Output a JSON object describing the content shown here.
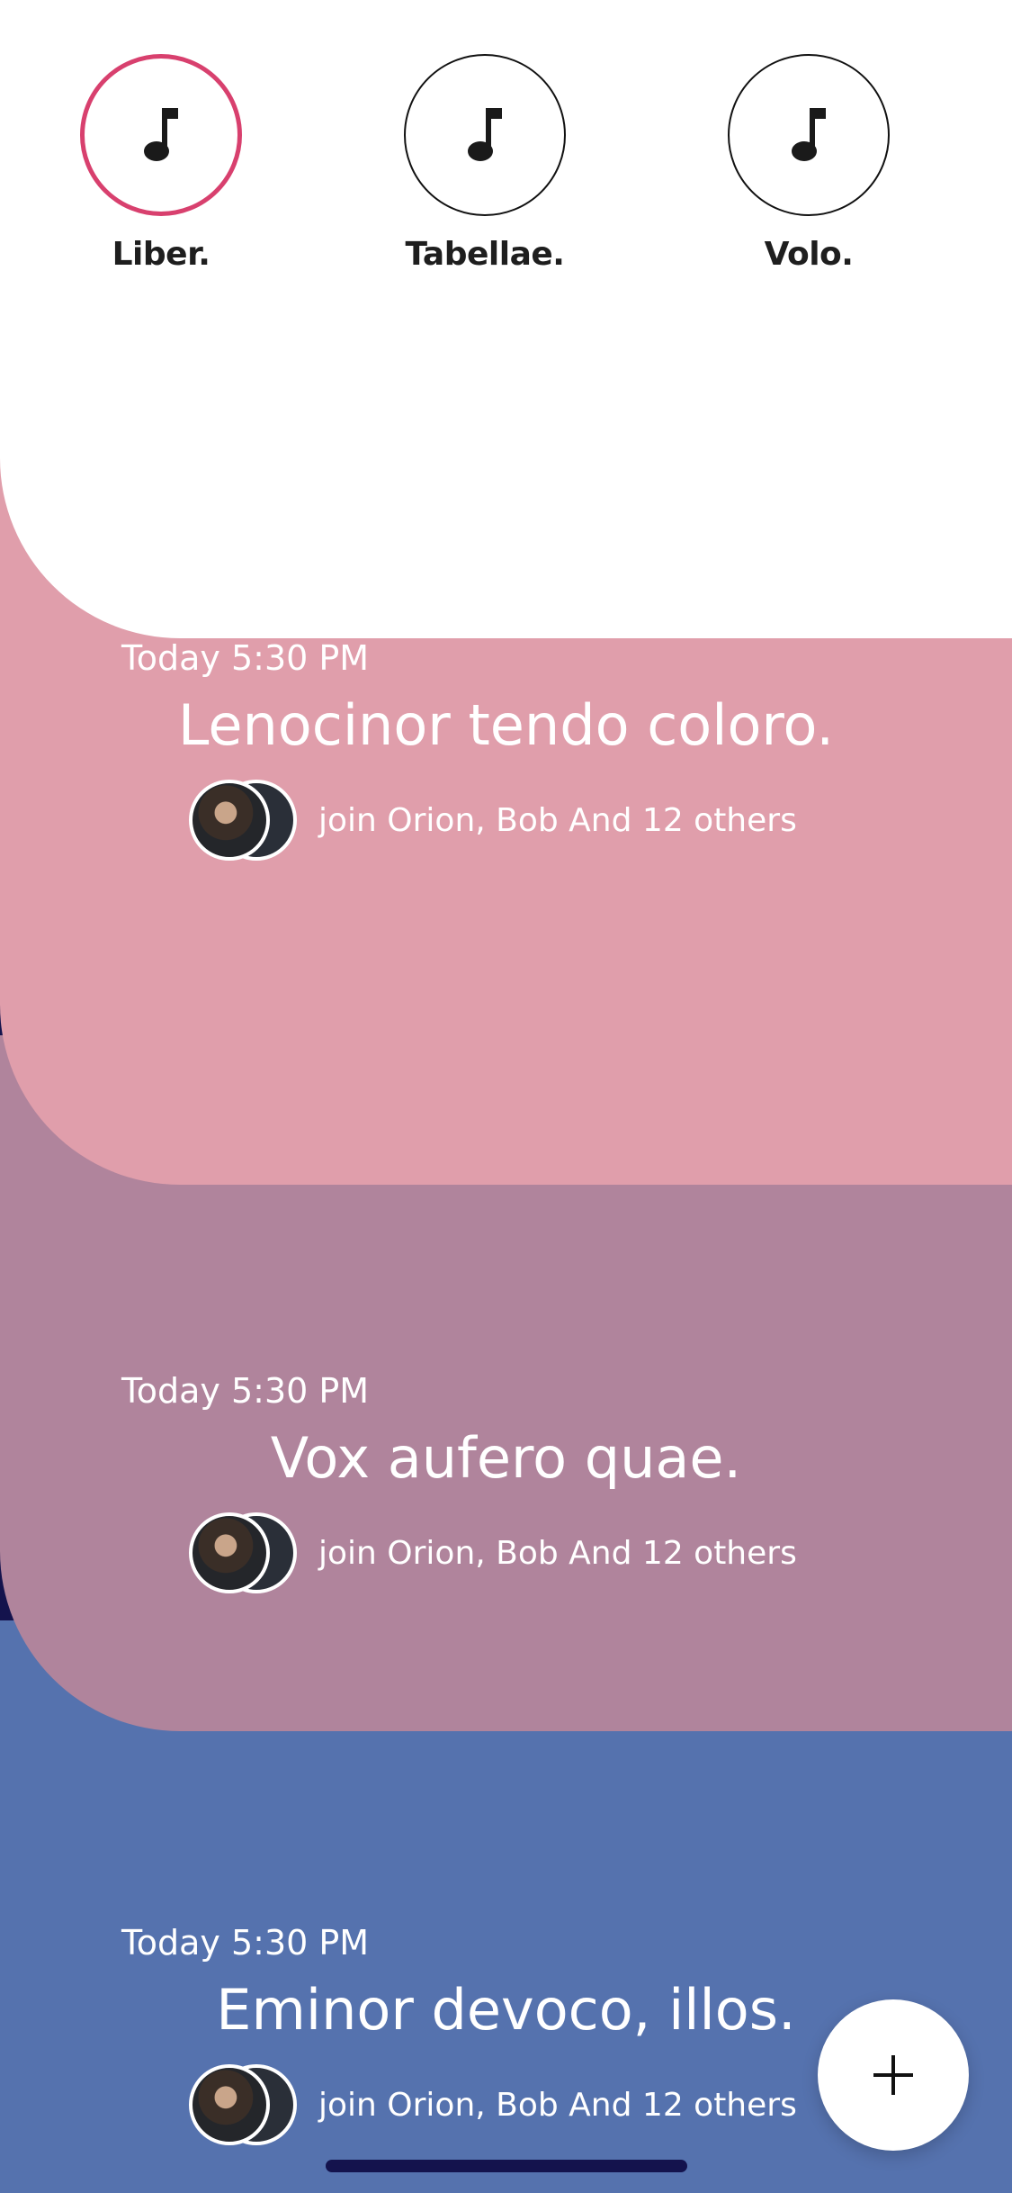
{
  "playlists": [
    {
      "label": "Liber.",
      "icon": "music-note-icon",
      "active": true
    },
    {
      "label": "Tabellae.",
      "icon": "music-note-icon",
      "active": false
    },
    {
      "label": "Volo.",
      "icon": "music-note-icon",
      "active": false
    }
  ],
  "events": [
    {
      "time": "Today 5:30 PM",
      "title": "Lenocinor tendo coloro.",
      "attendees": "join Orion, Bob And 12 others",
      "color": "#e09eab"
    },
    {
      "time": "Today 5:30 PM",
      "title": "Vox aufero quae.",
      "attendees": "join Orion, Bob And 12 others",
      "color": "#b0849c"
    },
    {
      "time": "Today 5:30 PM",
      "title": "Eminor devoco, illos.",
      "attendees": "join Orion, Bob And 12 others",
      "color": "#5572ae"
    }
  ],
  "colors": {
    "accent": "#d8406e",
    "background": "#14134d"
  },
  "fab": {
    "icon": "plus-icon"
  }
}
